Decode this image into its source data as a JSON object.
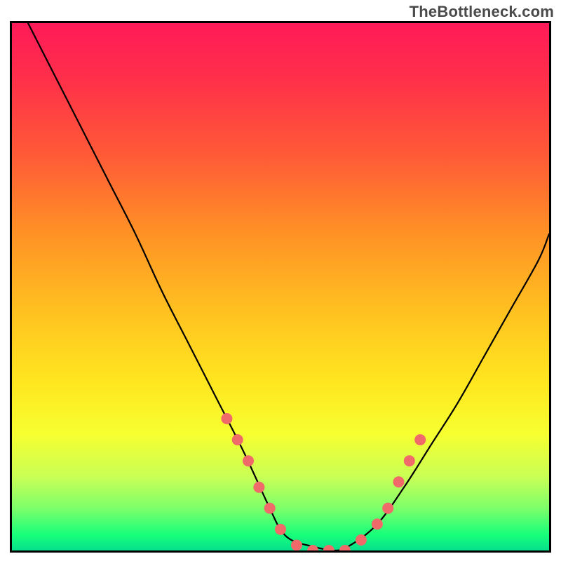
{
  "watermark": "TheBottleneck.com",
  "chart_data": {
    "type": "line",
    "title": "",
    "xlabel": "",
    "ylabel": "",
    "xlim": [
      0,
      100
    ],
    "ylim": [
      0,
      100
    ],
    "grid": false,
    "legend": null,
    "background_gradient": {
      "direction": "vertical",
      "stops": [
        {
          "pos": 0.0,
          "color": "#ff1a58"
        },
        {
          "pos": 0.25,
          "color": "#ff5a37"
        },
        {
          "pos": 0.55,
          "color": "#ffc220"
        },
        {
          "pos": 0.78,
          "color": "#f6ff30"
        },
        {
          "pos": 0.92,
          "color": "#7dff6a"
        },
        {
          "pos": 1.0,
          "color": "#05e08c"
        }
      ]
    },
    "series": [
      {
        "name": "curve",
        "color": "#000000",
        "x": [
          3,
          8,
          13,
          18,
          23,
          28,
          33,
          38,
          43,
          48,
          50,
          52,
          55,
          60,
          63,
          68,
          73,
          78,
          83,
          88,
          93,
          98,
          100
        ],
        "y": [
          100,
          90,
          80,
          70,
          60,
          49,
          39,
          29,
          19,
          8,
          4,
          2,
          1,
          0,
          1,
          5,
          12,
          20,
          28,
          37,
          46,
          55,
          60
        ]
      }
    ],
    "markers": {
      "name": "dots",
      "color": "#f06a6a",
      "radius": 8,
      "points": [
        {
          "x": 40,
          "y": 25
        },
        {
          "x": 42,
          "y": 21
        },
        {
          "x": 44,
          "y": 17
        },
        {
          "x": 46,
          "y": 12
        },
        {
          "x": 48,
          "y": 8
        },
        {
          "x": 50,
          "y": 4
        },
        {
          "x": 53,
          "y": 1
        },
        {
          "x": 56,
          "y": 0
        },
        {
          "x": 59,
          "y": 0
        },
        {
          "x": 62,
          "y": 0
        },
        {
          "x": 65,
          "y": 2
        },
        {
          "x": 68,
          "y": 5
        },
        {
          "x": 70,
          "y": 8
        },
        {
          "x": 72,
          "y": 13
        },
        {
          "x": 74,
          "y": 17
        },
        {
          "x": 76,
          "y": 21
        }
      ]
    }
  }
}
